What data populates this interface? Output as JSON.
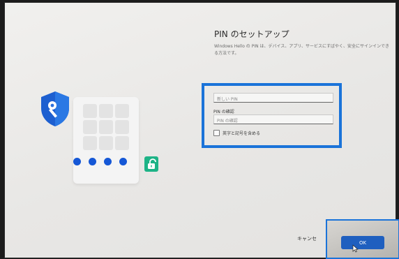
{
  "page": {
    "title": "PIN のセットアップ",
    "description": "Windows Hello の PIN は、デバイス、アプリ、サービスにすばやく、安全にサインインできる方法です。"
  },
  "form": {
    "new_pin_placeholder": "新しい PIN",
    "confirm_label": "PIN の確認",
    "confirm_placeholder": "PIN の確認",
    "checkbox_label": "英字と記号を含める",
    "checkbox_checked": false
  },
  "buttons": {
    "cancel": "キャンセ",
    "ok": "OK"
  },
  "icons": {
    "shield": "shield-key-icon",
    "lock": "unlocked-padlock-icon",
    "cursor": "mouse-pointer-icon"
  },
  "colors": {
    "accent": "#1a73d9",
    "pin_dot": "#1557d6",
    "lock_bg": "#1db386",
    "ok_button": "#1f5fbf"
  }
}
